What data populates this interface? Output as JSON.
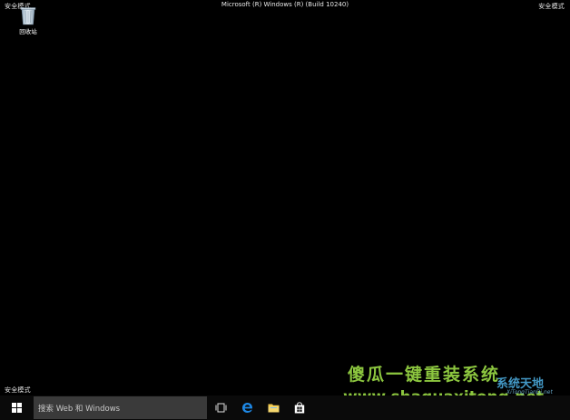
{
  "screen": {
    "safe_mode_label": "安全模式",
    "build_title": "Microsoft (R) Windows (R) (Build 10240)"
  },
  "desktop": {
    "icons": [
      {
        "label": "回收站",
        "icon": "recycle-bin-icon"
      }
    ]
  },
  "taskbar": {
    "search_placeholder": "搜索 Web 和 Windows",
    "pinned": [
      "task-view-icon",
      "edge-icon",
      "file-explorer-icon",
      "store-icon"
    ]
  },
  "watermark": {
    "title": "傻瓜一键重装系统",
    "url": "www.shaguaxitong.net",
    "logo_text": "系统天地",
    "logo_sub": "XiTongTianDi.net"
  },
  "colors": {
    "desktop_bg": "#000000",
    "taskbar_bg": "#0a0a0a",
    "search_bg": "#3a3a3a",
    "watermark_green": "#8cc63f",
    "edge_blue": "#1e88e5"
  }
}
